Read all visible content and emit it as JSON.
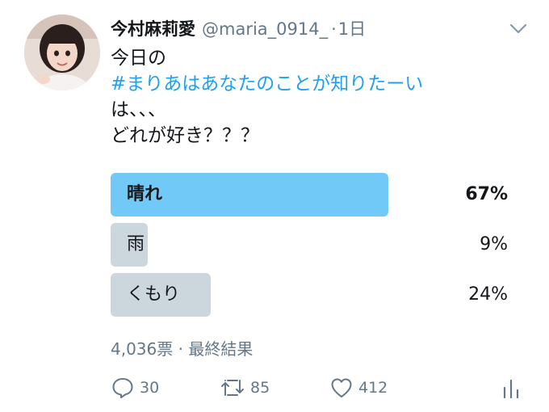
{
  "tweet": {
    "author_name": "今村麻莉愛",
    "handle": "@maria_0914_",
    "separator": "·",
    "time": "1日",
    "body_line1": "今日の",
    "hashtag": "#まりあはあなたのことが知りたーい",
    "body_line3": "は、、、",
    "body_line4": "どれが好き？？？"
  },
  "poll": {
    "options": [
      {
        "label": "晴れ",
        "percent_text": "67%",
        "percent": 67,
        "winner": true
      },
      {
        "label": "雨",
        "percent_text": "9%",
        "percent": 9,
        "winner": false
      },
      {
        "label": "くもり",
        "percent_text": "24%",
        "percent": 24,
        "winner": false
      }
    ],
    "meta": "4,036票 · 最終結果"
  },
  "actions": {
    "reply_count": "30",
    "retweet_count": "85",
    "like_count": "412"
  },
  "icons": {
    "caret": "chevron-down-icon",
    "reply": "reply-icon",
    "retweet": "retweet-icon",
    "like": "heart-icon",
    "analytics": "analytics-icon"
  },
  "colors": {
    "accent": "#1da1f2",
    "winner_bar": "#71c9f8",
    "bar": "#ccd6dd",
    "muted": "#657786"
  }
}
